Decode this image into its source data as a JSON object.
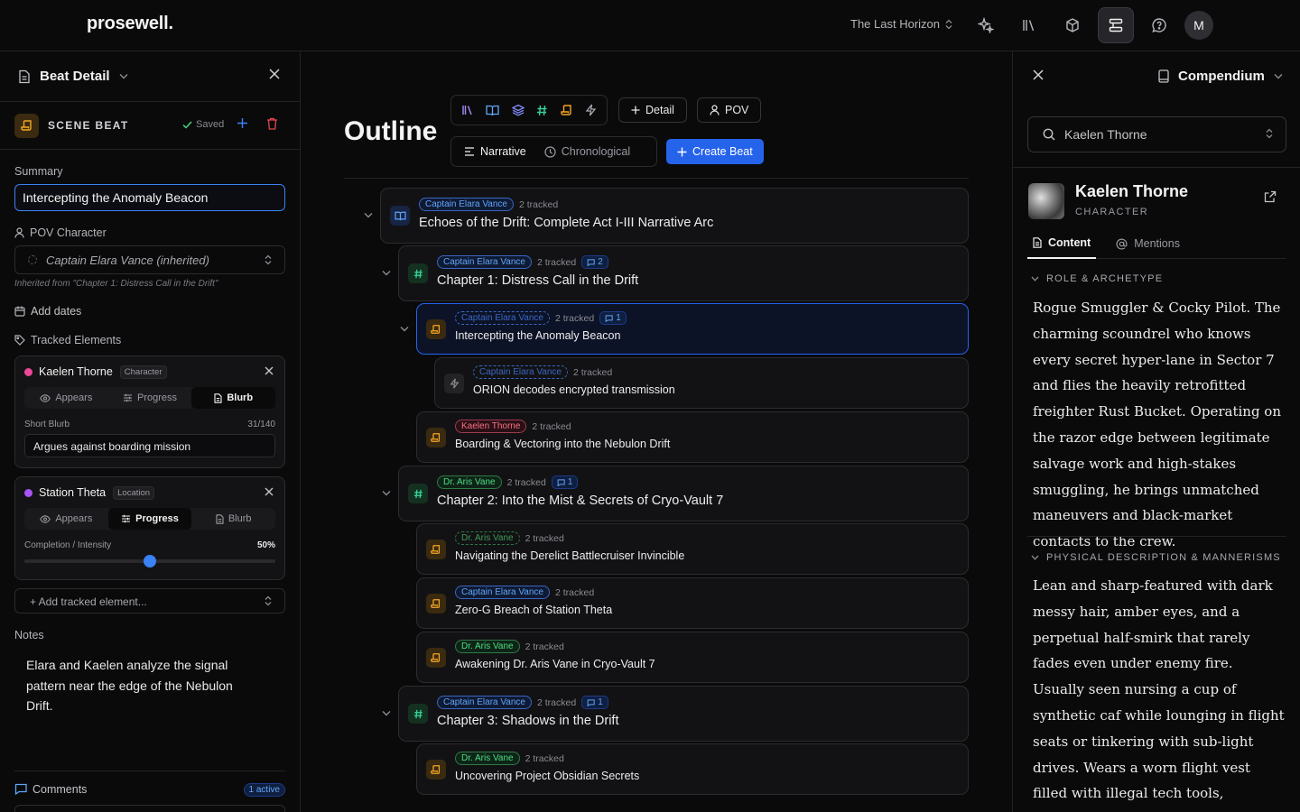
{
  "app": {
    "brand": "prosewell.",
    "project": "The Last Horizon",
    "avatar_initial": "M"
  },
  "left": {
    "title": "Beat Detail",
    "beat_type": "SCENE BEAT",
    "saved": "Saved",
    "summary_label": "Summary",
    "summary_value": "Intercepting the Anomaly Beacon",
    "pov_label": "POV Character",
    "pov_value": "Captain Elara Vance (inherited)",
    "inherited_note": "Inherited from \"Chapter 1: Distress Call in the Drift\"",
    "add_dates": "Add dates",
    "tracked_label": "Tracked Elements",
    "tracked": [
      {
        "name": "Kaelen Thorne",
        "type": "Character",
        "color": "#ec4899",
        "tabs": [
          "Appears",
          "Progress",
          "Blurb"
        ],
        "active_tab": "Blurb",
        "field_label": "Short Blurb",
        "count": "31/140",
        "value": "Argues against boarding mission"
      },
      {
        "name": "Station Theta",
        "type": "Location",
        "color": "#a855f7",
        "tabs": [
          "Appears",
          "Progress",
          "Blurb"
        ],
        "active_tab": "Progress",
        "field_label": "Completion / Intensity",
        "percent_label": "50%",
        "progress": 0.5
      }
    ],
    "add_tracked": "+ Add tracked element...",
    "notes_label": "Notes",
    "notes_text": "Elara and Kaelen analyze the signal pattern near the edge of the Nebulon Drift.",
    "comments_label": "Comments",
    "comments_badge": "1 active"
  },
  "outline": {
    "title": "Outline",
    "detail_btn": "Detail",
    "pov_btn": "POV",
    "modes": [
      "Narrative",
      "Chronological"
    ],
    "active_mode": "Narrative",
    "create_btn": "Create Beat",
    "nodes": [
      {
        "kind": "book",
        "pov": "Captain Elara Vance",
        "pill": "blue",
        "tracked": "2 tracked",
        "comments": "",
        "title": "Echoes of the Drift: Complete Act I-III Narrative Arc"
      },
      {
        "kind": "hash",
        "pov": "Captain Elara Vance",
        "pill": "blue",
        "tracked": "2 tracked",
        "comments": "2",
        "title": "Chapter 1: Distress Call in the Drift"
      },
      {
        "kind": "beat",
        "pov": "Captain Elara Vance",
        "pill": "blue dashed",
        "tracked": "2 tracked",
        "comments": "1",
        "title": "Intercepting the Anomaly Beacon"
      },
      {
        "kind": "bolt",
        "pov": "Captain Elara Vance",
        "pill": "blue dashed",
        "tracked": "2 tracked",
        "comments": "",
        "title": "ORION decodes encrypted transmission"
      },
      {
        "kind": "beat",
        "pov": "Kaelen Thorne",
        "pill": "pink",
        "tracked": "2 tracked",
        "comments": "",
        "title": "Boarding & Vectoring into the Nebulon Drift"
      },
      {
        "kind": "hash",
        "pov": "Dr. Aris Vane",
        "pill": "green",
        "tracked": "2 tracked",
        "comments": "1",
        "title": "Chapter 2: Into the Mist & Secrets of Cryo-Vault 7"
      },
      {
        "kind": "beat",
        "pov": "Dr. Aris Vane",
        "pill": "green dashed",
        "tracked": "2 tracked",
        "comments": "",
        "title": "Navigating the Derelict Battlecruiser Invincible"
      },
      {
        "kind": "beat",
        "pov": "Captain Elara Vance",
        "pill": "blue",
        "tracked": "2 tracked",
        "comments": "",
        "title": "Zero-G Breach of Station Theta"
      },
      {
        "kind": "beat",
        "pov": "Dr. Aris Vane",
        "pill": "green",
        "tracked": "2 tracked",
        "comments": "",
        "title": "Awakening Dr. Aris Vane in Cryo-Vault 7"
      },
      {
        "kind": "hash",
        "pov": "Captain Elara Vance",
        "pill": "blue",
        "tracked": "2 tracked",
        "comments": "1",
        "title": "Chapter 3: Shadows in the Drift"
      },
      {
        "kind": "beat",
        "pov": "Dr. Aris Vane",
        "pill": "green",
        "tracked": "2 tracked",
        "comments": "",
        "title": "Uncovering Project Obsidian Secrets"
      }
    ]
  },
  "compendium": {
    "title": "Compendium",
    "search_value": "Kaelen Thorne",
    "entry_name": "Kaelen Thorne",
    "entry_type": "CHARACTER",
    "tabs": [
      "Content",
      "Mentions"
    ],
    "active_tab": "Content",
    "sections": [
      {
        "heading": "ROLE & ARCHETYPE",
        "text": "Rogue Smuggler & Cocky Pilot. The charming scoundrel who knows every secret hyper-lane in Sector 7 and flies the heavily retrofitted freighter Rust Bucket. Operating on the razor edge between legitimate salvage work and high-stakes smuggling, he brings unmatched maneuvers and black-market contacts to the crew."
      },
      {
        "heading": "PHYSICAL DESCRIPTION & MANNERISMS",
        "text": "Lean and sharp-featured with dark messy hair, amber eyes, and a perpetual half-smirk that rarely fades even under enemy fire. Usually seen nursing a cup of synthetic caf while lounging in flight seats or tinkering with sub-light drives. Wears a worn flight vest filled with illegal tech tools, wiretaps, and contraband override"
      }
    ]
  },
  "colors": {
    "accent": "#2563eb",
    "beat": "#f5a623",
    "chapter": "#34d399",
    "act": "#60a5fa"
  }
}
